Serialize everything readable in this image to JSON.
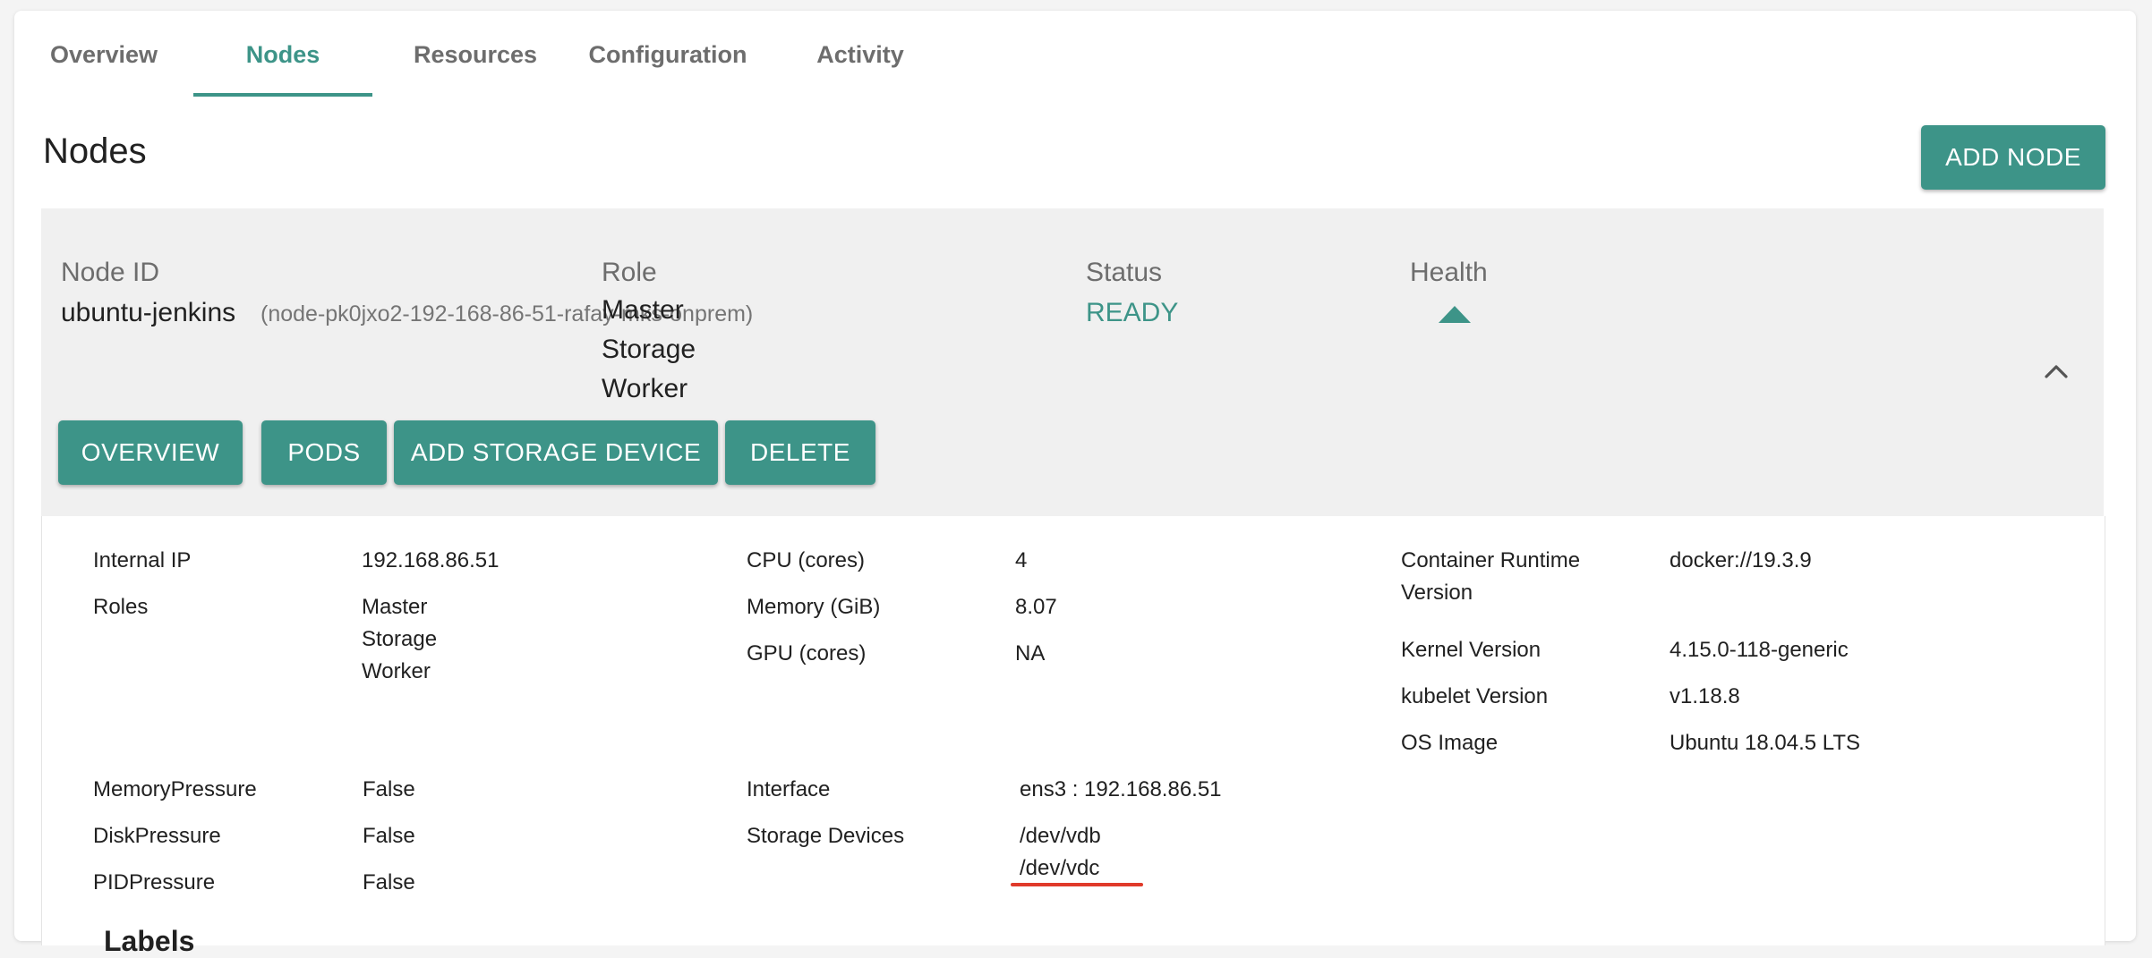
{
  "tabs": [
    {
      "label": "Overview"
    },
    {
      "label": "Nodes"
    },
    {
      "label": "Resources"
    },
    {
      "label": "Configuration"
    },
    {
      "label": "Activity"
    }
  ],
  "page_title": "Nodes",
  "add_node_label": "ADD NODE",
  "node": {
    "headers": {
      "node_id": "Node ID",
      "role": "Role",
      "status": "Status",
      "health": "Health"
    },
    "name": "ubuntu-jenkins",
    "full_id": "(node-pk0jxo2-192-168-86-51-rafay-mks-onprem)",
    "roles": [
      "Master",
      "Storage",
      "Worker"
    ],
    "status": "READY",
    "health_icon": "triangle-up-icon",
    "actions": {
      "overview": "OVERVIEW",
      "pods": "PODS",
      "add_storage": "ADD STORAGE DEVICE",
      "delete": "DELETE"
    }
  },
  "details": {
    "internal_ip_label": "Internal IP",
    "internal_ip": "192.168.86.51",
    "roles_label": "Roles",
    "roles": [
      "Master",
      "Storage",
      "Worker"
    ],
    "cpu_label": "CPU (cores)",
    "cpu": "4",
    "memory_label": "Memory (GiB)",
    "memory": "8.07",
    "gpu_label": "GPU (cores)",
    "gpu": "NA",
    "runtime_label_1": "Container Runtime",
    "runtime_label_2": "Version",
    "runtime": "docker://19.3.9",
    "kernel_label": "Kernel Version",
    "kernel": "4.15.0-118-generic",
    "kubelet_label": "kubelet Version",
    "kubelet": "v1.18.8",
    "os_label": "OS Image",
    "os": "Ubuntu 18.04.5 LTS",
    "mem_pressure_label": "MemoryPressure",
    "mem_pressure": "False",
    "disk_pressure_label": "DiskPressure",
    "disk_pressure": "False",
    "pid_pressure_label": "PIDPressure",
    "pid_pressure": "False",
    "interface_label": "Interface",
    "interface": "ens3 : 192.168.86.51",
    "storage_label": "Storage Devices",
    "storage": [
      "/dev/vdb",
      "/dev/vdc"
    ]
  },
  "labels_heading": "Labels",
  "colors": {
    "accent": "#3d9488",
    "annotation": "#e03a2a"
  }
}
